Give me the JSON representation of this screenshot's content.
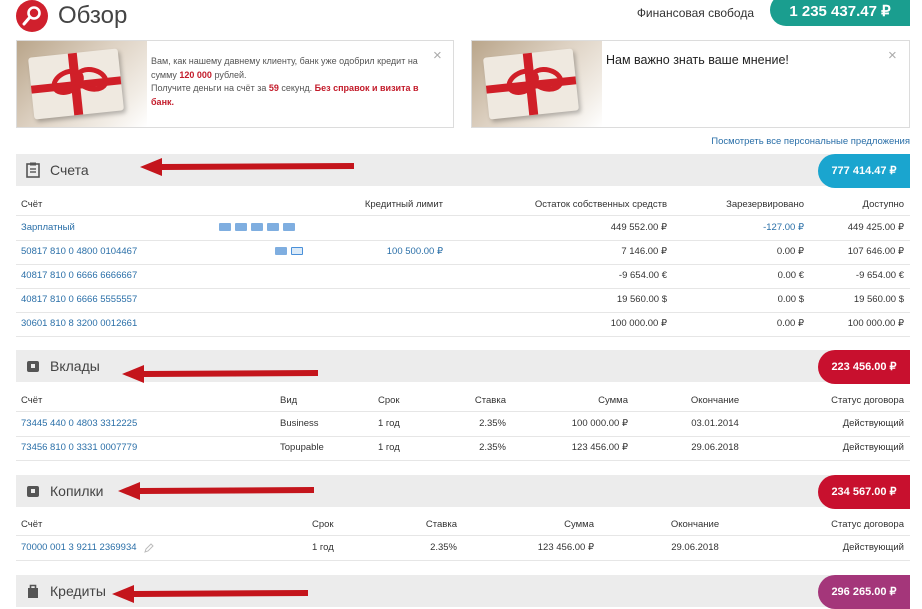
{
  "header": {
    "title": "Обзор",
    "financial_label": "Финансовая свобода",
    "financial_total": "1 235 437.47 ₽"
  },
  "banners": {
    "credit_text_1": "Вам, как нашему давнему клиенту, банк уже одобрил кредит на сумму",
    "credit_amount": "120 000",
    "credit_text_2": "рублей.",
    "credit_text_3": "Получите деньги на счёт за",
    "credit_seconds": "59",
    "credit_text_4": "секунд.",
    "credit_text_5": "Без справок и визита в банк.",
    "feedback_text": "Нам важно знать ваше мнение!",
    "close": "×"
  },
  "all_offers_link": "Посмотреть все персональные предложения",
  "accounts": {
    "title": "Счета",
    "total": "777 414.47 ₽",
    "total_color": "#1aa5cf",
    "columns": [
      "Счёт",
      "Кредитный лимит",
      "Остаток собственных средств",
      "Зарезервировано",
      "Доступно"
    ],
    "rows": [
      {
        "name": "Зарплатный",
        "limit": "",
        "balance": "449 552.00 ₽",
        "reserved": "-127.00 ₽",
        "available": "449 425.00 ₽"
      },
      {
        "name": "50817 810 0 4800 0104467",
        "limit": "100 500.00 ₽",
        "balance": "7 146.00 ₽",
        "reserved": "0.00 ₽",
        "available": "107 646.00 ₽"
      },
      {
        "name": "40817 810 0 6666 6666667",
        "limit": "",
        "balance": "-9 654.00 €",
        "reserved": "0.00 €",
        "available": "-9 654.00 €"
      },
      {
        "name": "40817 810 0 6666 5555557",
        "limit": "",
        "balance": "19 560.00 $",
        "reserved": "0.00 $",
        "available": "19 560.00 $"
      },
      {
        "name": "30601 810 8 3200 0012661",
        "limit": "",
        "balance": "100 000.00 ₽",
        "reserved": "0.00 ₽",
        "available": "100 000.00 ₽"
      }
    ]
  },
  "deposits": {
    "title": "Вклады",
    "total": "223 456.00 ₽",
    "total_color": "#c8102e",
    "columns": [
      "Счёт",
      "Вид",
      "Срок",
      "Ставка",
      "Сумма",
      "Окончание",
      "Статус договора"
    ],
    "rows": [
      {
        "name": "73445 440 0 4803 3312225",
        "type": "Business",
        "term": "1 год",
        "rate": "2.35%",
        "sum": "100 000.00 ₽",
        "end": "03.01.2014",
        "status": "Действующий"
      },
      {
        "name": "73456 810 0 3331 0007779",
        "type": "Topupable",
        "term": "1 год",
        "rate": "2.35%",
        "sum": "123 456.00 ₽",
        "end": "29.06.2018",
        "status": "Действующий"
      }
    ]
  },
  "savings": {
    "title": "Копилки",
    "total": "234 567.00 ₽",
    "total_color": "#c8102e",
    "columns": [
      "Счёт",
      "Срок",
      "Ставка",
      "Сумма",
      "Окончание",
      "Статус договора"
    ],
    "rows": [
      {
        "name": "70000 001 3 9211 2369934",
        "term": "1 год",
        "rate": "2.35%",
        "sum": "123 456.00 ₽",
        "end": "29.06.2018",
        "status": "Действующий"
      }
    ]
  },
  "credits": {
    "title": "Кредиты",
    "total": "296 265.00 ₽",
    "total_color": "#a4367a"
  },
  "icons": {
    "logo": "search-icon",
    "accounts": "clipboard-icon",
    "deposits": "piggy-icon",
    "savings": "piggy-icon",
    "credits": "bag-icon",
    "annotation": "red-arrow-icon",
    "edit": "edit-icon"
  },
  "colors": {
    "brand_red": "#d0202d",
    "financial_freedom": "#1a9e8f",
    "link": "#2a6fa8",
    "arrow": "#c4151c"
  }
}
